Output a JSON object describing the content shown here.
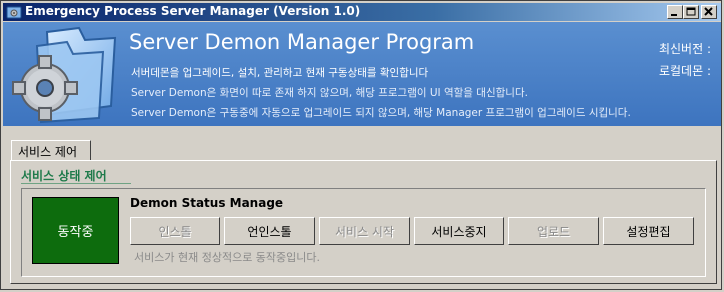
{
  "window": {
    "title": "Emergency Process Server Manager (Version 1.0)"
  },
  "banner": {
    "heading": "Server Demon Manager Program",
    "line1": "서버데몬을 업그레이드, 설치, 관리하고 현재 구동상태를 확인합니다",
    "line2": "Server Demon은 화면이 따로 존재 하지 않으며, 해당 프로그램이 UI 역할을 대신합니다.",
    "line3": "Server Demon은 구동중에 자동으로 업그레이드 되지 않으며, 해당 Manager 프로그램이 업그레이드 시킵니다.",
    "latest_version_label": "최신버전 :",
    "local_demon_label": "로컬데몬 :"
  },
  "tabs": [
    {
      "label": "서비스 제어",
      "selected": true
    }
  ],
  "section": {
    "title": "서비스 상태 제어"
  },
  "group": {
    "title": "Demon Status Manage",
    "status": {
      "label": "동작중",
      "color": "#0d6c0d"
    },
    "buttons": [
      {
        "label": "인스톨",
        "enabled": false
      },
      {
        "label": "언인스톨",
        "enabled": true
      },
      {
        "label": "서비스 시작",
        "enabled": false
      },
      {
        "label": "서비스중지",
        "enabled": true
      },
      {
        "label": "업로드",
        "enabled": false
      },
      {
        "label": "설정편집",
        "enabled": true
      }
    ],
    "message": "서비스가 현재 정상적으로 동작중입니다."
  },
  "icons": {
    "app": "gear-folder-icon",
    "logo": "folder-gear-icon"
  },
  "colors": {
    "banner": "#4a82c8",
    "title_bar": "#0a246a",
    "section_title": "#1e7a4a",
    "status_running": "#0d6c0d"
  }
}
